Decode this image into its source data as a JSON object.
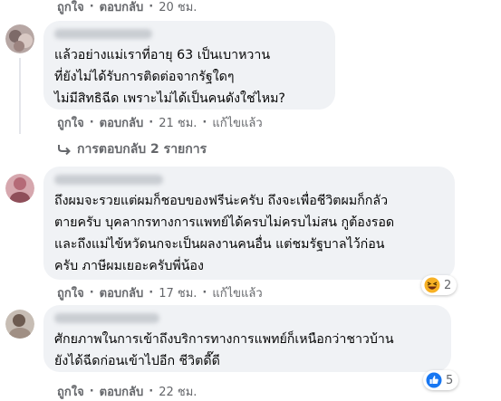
{
  "top_actions": {
    "like": "ถูกใจ",
    "reply": "ตอบกลับ",
    "time": "20 ชม."
  },
  "comments": [
    {
      "text": "แล้วอย่างแม่เราที่อายุ 63 เป็นเบาหวาน\nที่ยังไม่ได้รับการติดต่อจากรัฐใดๆ\nไม่มีสิทธิฉีด เพราะไม่ได้เป็นคนดังใช่ไหม?",
      "like": "ถูกใจ",
      "reply": "ตอบกลับ",
      "time": "21 ชม.",
      "edited": "แก้ไขแล้ว",
      "replies_label": "การตอบกลับ 2 รายการ"
    },
    {
      "text": "ถึงผมจะรวยแต่ผมก็ชอบของฟรีน่ะครับ ถึงจะเพื่อชีวิตผมก็กลัว\nตายครับ บุคลากรทางการแพทย์ได้ครบไม่ครบไม่สน กูต้องรอด\nและถึงแม่ไข้หวัดนกจะเป็นผลงานคนอื่น แต่ชมรัฐบาลไว้ก่อน\nครับ ภาษีผมเยอะครับพี่น้อง",
      "like": "ถูกใจ",
      "reply": "ตอบกลับ",
      "time": "17 ชม.",
      "edited": "แก้ไขแล้ว",
      "reaction": {
        "icon": "haha-emoji-icon",
        "count": "2"
      }
    },
    {
      "text": "ศักยภาพในการเข้าถึงบริการทางการแพทย์ก็เหนือกว่าชาวบ้าน\nยังได้ฉีดก่อนเข้าไปอีก ชีวิตดี๊ดี",
      "like": "ถูกใจ",
      "reply": "ตอบกลับ",
      "time": "22 ชม.",
      "reaction": {
        "icon": "like-thumb-icon",
        "count": "5"
      }
    }
  ],
  "colors": {
    "bubble": "#f0f2f5",
    "meta": "#65676b",
    "like_blue": "#1877f2",
    "haha_yellow": "#f7b125"
  }
}
